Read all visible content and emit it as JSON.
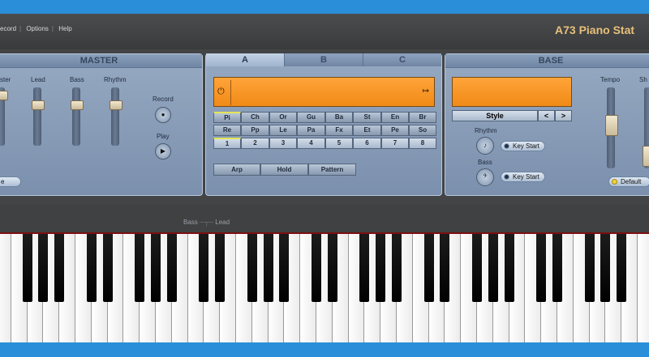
{
  "menu": {
    "items": [
      "ecord",
      "Options",
      "Help"
    ]
  },
  "app": {
    "title": "A73 Piano Stat"
  },
  "master": {
    "header": "MASTER",
    "sliders": [
      {
        "label": "ster",
        "level": 0.9
      },
      {
        "label": "Lead",
        "level": 0.85
      },
      {
        "label": "Bass",
        "level": 0.85
      },
      {
        "label": "Rhythm",
        "level": 0.85
      }
    ],
    "record_label": "Record",
    "play_label": "Play",
    "bottom_pill": "e"
  },
  "sound": {
    "tabs": [
      "A",
      "B",
      "C"
    ],
    "active_tab": "A",
    "row1": [
      "Pi",
      "Ch",
      "Or",
      "Gu",
      "Ba",
      "St",
      "En",
      "Br"
    ],
    "row2": [
      "Re",
      "Pp",
      "Le",
      "Pa",
      "Fx",
      "Et",
      "Pe",
      "So"
    ],
    "row3": [
      "1",
      "2",
      "3",
      "4",
      "5",
      "6",
      "7",
      "8"
    ],
    "modes": [
      "Arp",
      "Hold",
      "Pattern"
    ],
    "power_icon": "⏻",
    "range_icon": "↦"
  },
  "base": {
    "header": "BASE",
    "style_label": "Style",
    "prev": "<",
    "next": ">",
    "rhythm_label": "Rhythm",
    "bass_label": "Bass",
    "key_start_1": "Key Start",
    "key_start_2": "Key Start",
    "tempo_label": "Tempo",
    "tempo_level": 0.55,
    "sh_label": "Sh",
    "default_label": "Default"
  },
  "connector": {
    "left": "Bass",
    "right": "Lead"
  },
  "colors": {
    "lcd": "#f6931f",
    "frame": "#2a8fd8",
    "title": "#e7c07a"
  }
}
